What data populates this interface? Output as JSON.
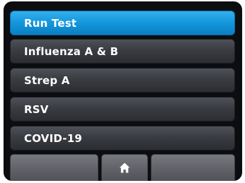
{
  "menu": {
    "items": [
      {
        "label": "Run Test",
        "active": true
      },
      {
        "label": "Influenza A & B",
        "active": false
      },
      {
        "label": "Strep A",
        "active": false
      },
      {
        "label": "RSV",
        "active": false
      },
      {
        "label": "COVID-19",
        "active": false
      }
    ]
  },
  "bottom_bar": {
    "left_button_icon": "none",
    "center_button_icon": "home-icon",
    "right_button_icon": "none"
  },
  "colors": {
    "active_item": "#1496dc",
    "inactive_item": "#3a3c42",
    "background": "#0c0d10"
  }
}
